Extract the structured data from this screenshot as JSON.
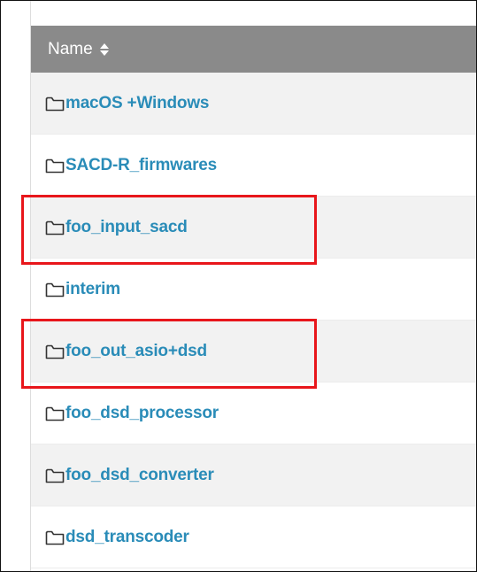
{
  "table": {
    "header": {
      "name_label": "Name",
      "sort_icon": "sort-up-down-icon"
    },
    "rows": [
      {
        "name": "macOS +Windows",
        "icon": "folder-icon",
        "highlighted": false
      },
      {
        "name": "SACD-R_firmwares",
        "icon": "folder-icon",
        "highlighted": false
      },
      {
        "name": "foo_input_sacd",
        "icon": "folder-icon",
        "highlighted": true
      },
      {
        "name": "interim",
        "icon": "folder-icon",
        "highlighted": false
      },
      {
        "name": "foo_out_asio+dsd",
        "icon": "folder-icon",
        "highlighted": true
      },
      {
        "name": "foo_dsd_processor",
        "icon": "folder-icon",
        "highlighted": false
      },
      {
        "name": "foo_dsd_converter",
        "icon": "folder-icon",
        "highlighted": false
      },
      {
        "name": "dsd_transcoder",
        "icon": "folder-icon",
        "highlighted": false
      }
    ]
  },
  "colors": {
    "header_bg": "#8a8a8a",
    "link": "#2a8cb8",
    "highlight": "#e8161b",
    "row_alt": "#f2f2f2"
  }
}
